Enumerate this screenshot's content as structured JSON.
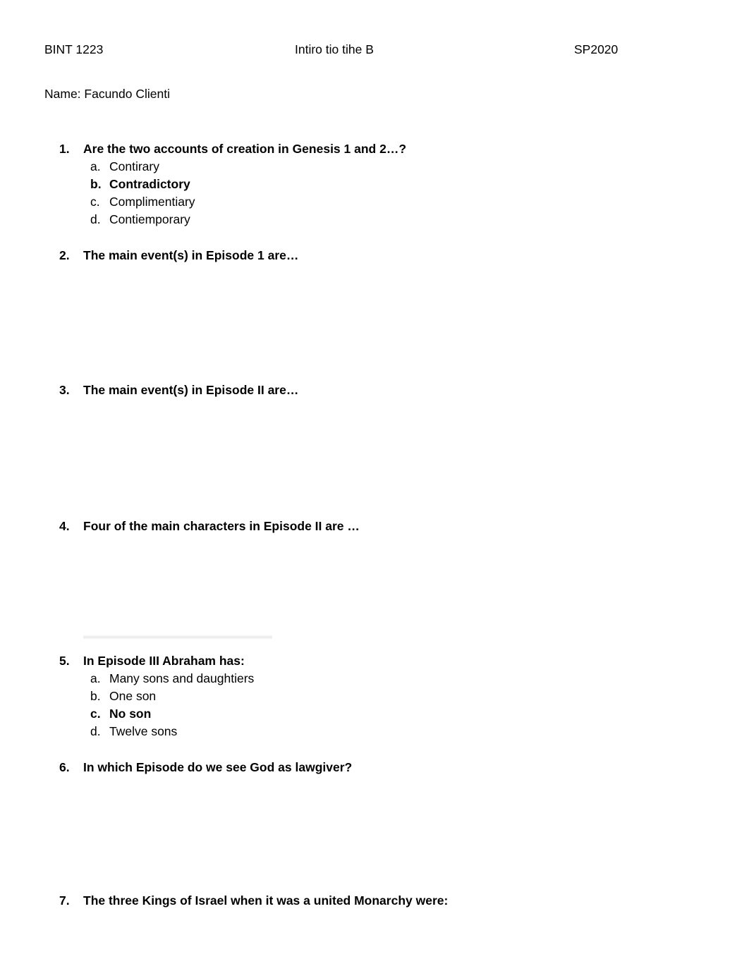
{
  "header": {
    "course_code": "BINT 1223",
    "title": "Intiro tio tihe B",
    "term": "SP2020"
  },
  "name_line": "Name: Facundo Clienti",
  "questions": [
    {
      "number": "1.",
      "text": "Are the two accounts of creation in Genesis 1 and 2…?",
      "options": [
        {
          "letter": "a.",
          "text": "Contirary",
          "bold": false
        },
        {
          "letter": "b.",
          "text": "Contradictory",
          "bold": true
        },
        {
          "letter": "c.",
          "text": "Complimentiary",
          "bold": false
        },
        {
          "letter": "d.",
          "text": "Contiemporary",
          "bold": false
        }
      ]
    },
    {
      "number": "2.",
      "text": "The main event(s) in Episode 1 are…",
      "options": []
    },
    {
      "number": "3.",
      "text": "The main event(s) in Episode II are…",
      "options": []
    },
    {
      "number": "4.",
      "text": "Four of the main characters in Episode II are …",
      "options": []
    },
    {
      "number": "5.",
      "text": "In Episode III Abraham has:",
      "options": [
        {
          "letter": "a.",
          "text": "Many sons and daughtiers",
          "bold": false
        },
        {
          "letter": "b.",
          "text": "One son",
          "bold": false
        },
        {
          "letter": "c.",
          "text": "No son",
          "bold": true
        },
        {
          "letter": "d.",
          "text": "Twelve sons",
          "bold": false
        }
      ]
    },
    {
      "number": "6.",
      "text": "In which Episode do we see God as lawgiver?",
      "options": []
    },
    {
      "number": "7.",
      "text": "The three Kings of Israel when it was a united Monarchy were:",
      "options": []
    }
  ],
  "layout": {
    "question_tops": [
      199,
      350,
      541,
      734,
      925,
      1076,
      1265
    ]
  },
  "colors": {
    "text": "#000000",
    "page_background": "#ffffff",
    "artifact_line": "#ebebeb"
  }
}
